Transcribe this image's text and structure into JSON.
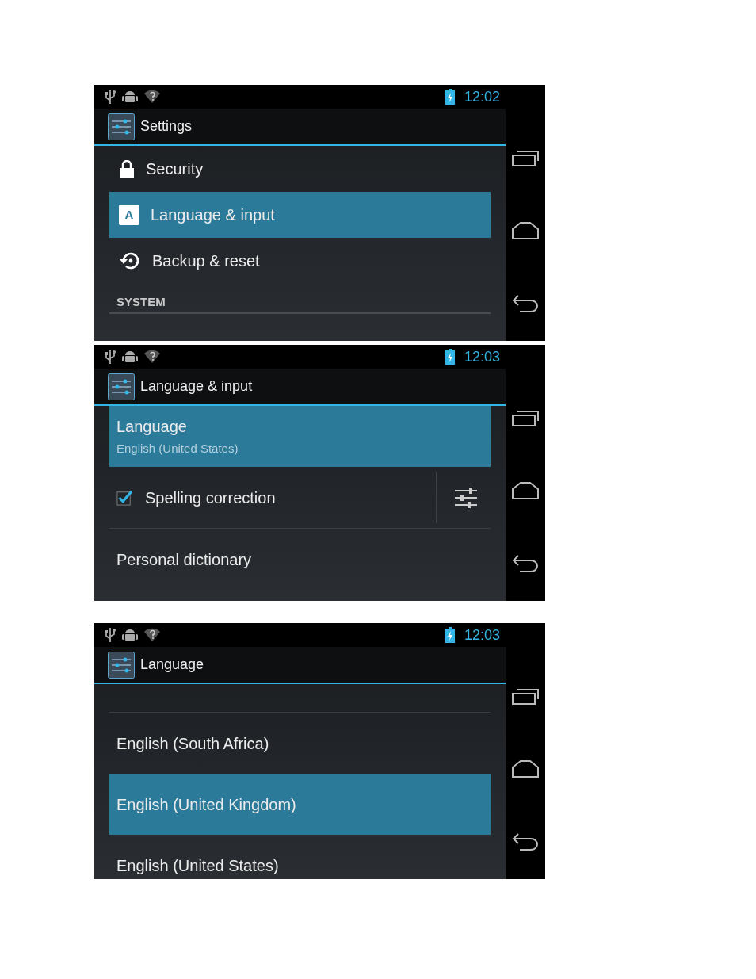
{
  "screens": [
    {
      "status_bar": {
        "time": "12:02"
      },
      "title": "Settings",
      "items": [
        {
          "kind": "icon_item",
          "label": "Security",
          "selected": false
        },
        {
          "kind": "icon_item",
          "label": "Language & input",
          "selected": true,
          "icon_letter": "A"
        },
        {
          "kind": "icon_item",
          "label": "Backup & reset",
          "selected": false
        },
        {
          "kind": "header",
          "label": "SYSTEM"
        }
      ]
    },
    {
      "status_bar": {
        "time": "12:03"
      },
      "title": "Language & input",
      "items": [
        {
          "kind": "two_line",
          "label": "Language",
          "summary": "English (United States)",
          "selected": true
        },
        {
          "kind": "checkbox_item",
          "label": "Spelling correction",
          "checked": true,
          "selected": false
        },
        {
          "kind": "item",
          "label": "Personal dictionary",
          "selected": false
        }
      ]
    },
    {
      "status_bar": {
        "time": "12:03"
      },
      "title": "Language",
      "items": [
        {
          "kind": "item",
          "label": "English (South Africa)",
          "selected": false
        },
        {
          "kind": "item",
          "label": "English (United Kingdom)",
          "selected": true
        },
        {
          "kind": "item",
          "label": "English (United States)",
          "selected": false
        }
      ]
    }
  ]
}
